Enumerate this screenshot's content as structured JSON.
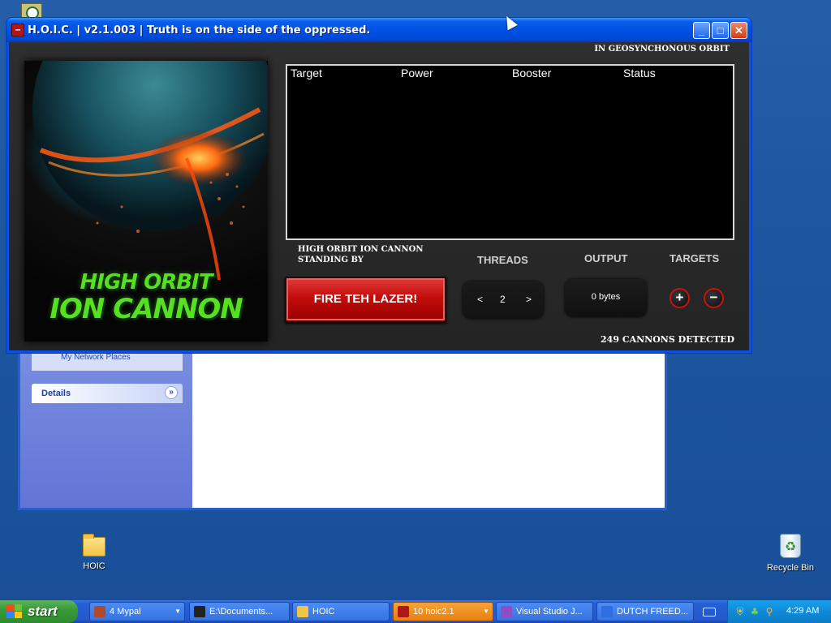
{
  "hoic": {
    "title": "H.O.I.C. | v2.1.003 | Truth is on the side of the oppressed.",
    "orbit_label": "IN GEOSYNCHONOUS ORBIT",
    "columns": [
      "Target",
      "Power",
      "Booster",
      "Status"
    ],
    "standing_label": "HIGH ORBIT ION CANNON STANDING BY",
    "poster_line1": "HIGH ORBIT",
    "poster_line2": "ION CANNON",
    "fire_label": "FIRE TEH LAZER!",
    "threads_label": "THREADS",
    "threads_dec": "<",
    "threads_value": "2",
    "threads_inc": ">",
    "output_label": "OUTPUT",
    "output_value": "0 bytes",
    "targets_label": "TARGETS",
    "add_target": "+",
    "remove_target": "−",
    "cannons_detected": "249 CANNONS DETECTED",
    "min_glyph": "_",
    "max_glyph": "□",
    "close_glyph": "✕"
  },
  "explorer": {
    "network_places": "My Network Places",
    "details_label": "Details",
    "chevron": "»"
  },
  "desktop_icons": {
    "hoic_folder": "HOIC",
    "recycle_bin": "Recycle Bin"
  },
  "taskbar": {
    "start_label": "start",
    "tasks": [
      {
        "label": "4 Mypal",
        "icon_color": "#b04a2a"
      },
      {
        "label": "E:\\Documents...",
        "icon_color": "#222222"
      },
      {
        "label": "HOIC",
        "icon_color": "#f2c443"
      },
      {
        "label": "10 hoic2.1",
        "icon_color": "#b01818"
      },
      {
        "label": "Visual Studio J...",
        "icon_color": "#8a4fc4"
      },
      {
        "label": "DUTCH FREED...",
        "icon_color": "#2e6fe0"
      }
    ],
    "clock": "4:29 AM"
  },
  "colors": {
    "fire_red": "#c40d0d",
    "poster_green": "#55e021",
    "taskbar_blue": "#2458cc",
    "active_task": "#e7800e"
  }
}
